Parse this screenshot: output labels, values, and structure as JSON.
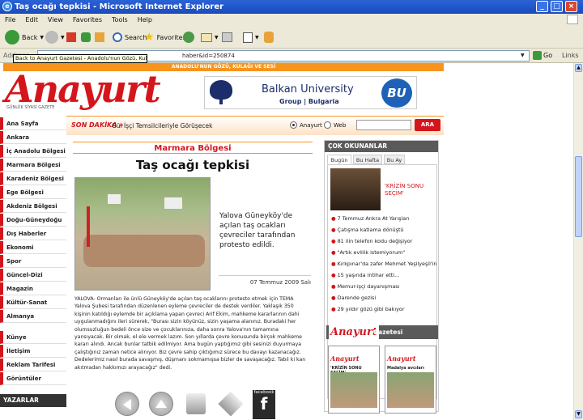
{
  "window": {
    "title": "Taş ocağı tepkisi - Microsoft Internet Explorer",
    "buttons": [
      "_",
      "□",
      "×"
    ]
  },
  "menu": [
    "File",
    "Edit",
    "View",
    "Favorites",
    "Tools",
    "Help"
  ],
  "toolbar": {
    "back_label": "Back",
    "search_label": "Search",
    "favorites_label": "Favorites"
  },
  "address": {
    "label": "Address",
    "url_fragment": "haber&id=250874",
    "go_label": "Go",
    "links_label": "Links"
  },
  "tooltip": "Back to Anayurt Gazetesi - Anadolu'nun Gözü, Kulağı ve Sesi",
  "site": {
    "slogan": "ANADOLU'NUN GÖZÜ, KULAĞI VE SESİ",
    "logo": "Anayurt",
    "logo_sub": "GÜNLÜK SİYASİ GAZETE",
    "banner": {
      "name": "Balkan University",
      "sub": "Group | Bulgaria",
      "mark": "BU"
    },
    "son_dakika_label": "SON DAKİKA »",
    "son_dakika_text": "Gül İşçi Temsilcileriyle Görüşecek",
    "search": {
      "option1": "Anayurt",
      "option2": "Web",
      "button": "ARA"
    }
  },
  "nav": [
    "Ana Sayfa",
    "Ankara",
    "İç Anadolu Bölgesi",
    "Marmara Bölgesi",
    "Karadeniz Bölgesi",
    "Ege Bölgesi",
    "Akdeniz Bölgesi",
    "Doğu-Güneydoğu",
    "Dış Haberler",
    "Ekonomi",
    "Spor",
    "Güncel-Dizi",
    "Magazin",
    "Kültür-Sanat",
    "Almanya",
    "Künye",
    "İletişim",
    "Reklam Tarifesi",
    "Görüntüler"
  ],
  "yazarlar": "YAZARLAR",
  "article": {
    "section": "Marmara Bölgesi",
    "headline": "Taş ocağı tepkisi",
    "summary": "Yalova Güneyköy'de açılan taş ocakları çevreciler tarafından protesto edildi.",
    "date": "07 Temmuz 2009 Salı",
    "body": "YALOVA- Ormanları ile ünlü Güneyköy'de açılan taş ocaklarını protesto etmek için TEMA Yalova Şubesi tarafından düzenlenen eyleme çevreciler de destek verdiler. Yaklaşık 350 kişinin katıldığı eylemde bir açıklama yapan çevreci Arif Ekim, mahkeme kararlarının dahi uygulanmadığını ileri sürerek, \"Burası sizin köyünüz, sizin yaşama alanınız. Buradaki her olumsuzluğun bedeli önce size ve çocuklarınıza, daha sonra Yalova'nın tamamına yansıyacak. Bir olmak, el ele vermek lazım. Son yıllarda çevre konusunda birçok mahkeme kararı alındı. Ancak bunlar tatbik edilmiyor. Ama bugün yaptığımız gibi sesinizi duyurmaya çalıştığınız zaman netice alınıyor. Biz çevre sahip çıktığımız sürece bu davayı kazanacağız. Dedelerimiz nasıl burada savaşmış, düşmanı sokmamışsa bizler de savaşacağız. Tabii ki kan akıtmadan hakkımızı arayacağız\" dedi."
  },
  "share": {
    "facebook_label": "facebook"
  },
  "sidebar": {
    "header": "ÇOK OKUNANLAR",
    "tabs": [
      "Bugün",
      "Bu Hafta",
      "Bu Ay"
    ],
    "featured": "'KRİZİN SONU SEÇİM'",
    "items": [
      "7 Temmuz Ankra At Yarışları",
      "Çatışma katlama dönüştü",
      "81 ilin telefon kodu değişiyor",
      "\"Artık evlilik istemiyorum\"",
      "Kırkpınar'da zafer Mehmet Yeşilyeşil'in",
      "15 yaşında intihar etti...",
      "Memur-işçi dayanışması",
      "Darende gezisi",
      "29 yıldır gözü gibi bakıyor"
    ],
    "gazete_logo": "Anayurt",
    "gazete_label": "Gazetesi",
    "papers": [
      {
        "head": "Anayurt",
        "title": "'KRİZİN SONU SEÇİM'"
      },
      {
        "head": "Anayurt",
        "title": "Madalya avcıları"
      }
    ]
  }
}
